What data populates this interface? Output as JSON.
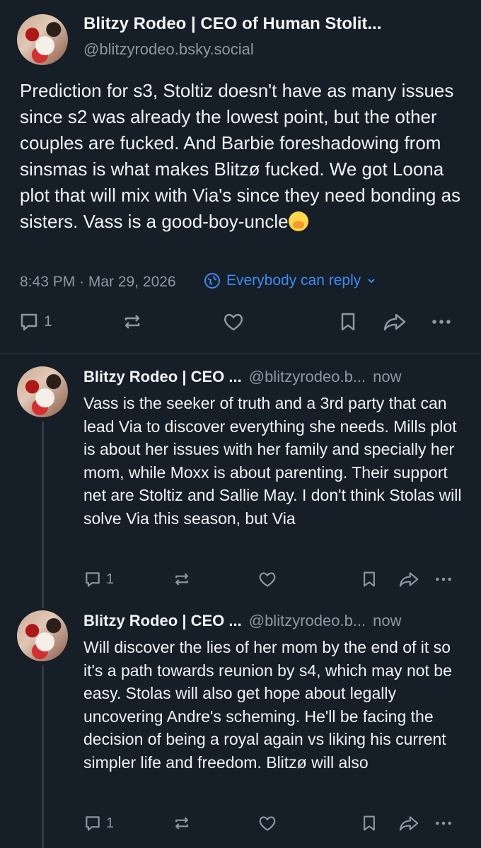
{
  "main_post": {
    "author_name": "Blitzy Rodeo | CEO of Human Stolit...",
    "handle": "@blitzyrodeo.bsky.social",
    "text": "Prediction for s3, Stoltiz doesn't have as many issues since s2 was already the lowest point, but the other couples are fucked. And Barbie foreshadowing from sinsmas is what makes Blitzø fucked. We got Loona plot that will mix with Via's since they need bonding as sisters. Vass is a good-boy-uncle",
    "emoji_icon": "hand-over-mouth-emoji",
    "timestamp": "8:43 PM · Mar 29, 2026",
    "reply_setting": "Everybody can reply",
    "reply_count": "1"
  },
  "replies": [
    {
      "author_name": "Blitzy Rodeo | CEO ...",
      "handle": "@blitzyrodeo.b...",
      "time": "now",
      "text": "Vass is the seeker of truth and a 3rd party that can lead Via to discover everything she needs. Mills plot is about her issues with her family and specially her mom, while Moxx is about parenting. Their support net are Stoltiz and Sallie May. I don't think Stolas will solve Via this season, but Via",
      "reply_count": "1"
    },
    {
      "author_name": "Blitzy Rodeo | CEO ...",
      "handle": "@blitzyrodeo.b...",
      "time": "now",
      "text": "Will discover the lies of her mom by the end of it so it's a path towards reunion by s4, which may not be easy. Stolas will also get hope about legally uncovering Andre's scheming. He'll be facing the decision of being a royal again vs liking his current simpler life and freedom. Blitzø will also",
      "reply_count": "1"
    }
  ],
  "colors": {
    "background": "#161e27",
    "text": "#f1f3f5",
    "muted": "#8b98a5",
    "accent": "#3b8cf2"
  }
}
